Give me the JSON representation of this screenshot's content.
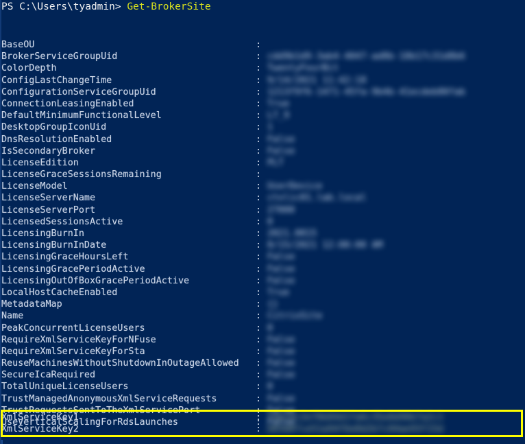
{
  "terminal": {
    "shell": "PowerShell",
    "background_color": "#012456",
    "prompt_prefix": "PS C:\\Users\\tyadmin> ",
    "command": "Get-BrokerSite",
    "command_color": "#d7e01f",
    "text_color": "#ccd5e6",
    "highlight_color": "#ffff00"
  },
  "output": {
    "properties": [
      {
        "name": "BaseOU",
        "value": ""
      },
      {
        "name": "BrokerServiceGroupUid",
        "value": "cdd9b1d9-3ab4-4047-ad8b-18b17c31d8b6"
      },
      {
        "name": "ColorDepth",
        "value": "TwentyFourBit"
      },
      {
        "name": "ConfigLastChangeTime",
        "value": "9/14/2021 11:42:18"
      },
      {
        "name": "ConfigurationServiceGroupUid",
        "value": "1213f9f6-1471-45fa-9b4b-41ecdeb80fab"
      },
      {
        "name": "ConnectionLeasingEnabled",
        "value": "True"
      },
      {
        "name": "DefaultMinimumFunctionalLevel",
        "value": "L7_9"
      },
      {
        "name": "DesktopGroupIconUid",
        "value": "1"
      },
      {
        "name": "DnsResolutionEnabled",
        "value": "False"
      },
      {
        "name": "IsSecondaryBroker",
        "value": "False"
      },
      {
        "name": "LicenseEdition",
        "value": "PLT"
      },
      {
        "name": "LicenseGraceSessionsRemaining",
        "value": ""
      },
      {
        "name": "LicenseModel",
        "value": "UserDevice"
      },
      {
        "name": "LicenseServerName",
        "value": "ctxlic01.lab.local"
      },
      {
        "name": "LicenseServerPort",
        "value": "27000"
      },
      {
        "name": "LicensedSessionsActive",
        "value": "0"
      },
      {
        "name": "LicensingBurnIn",
        "value": "2021.0815"
      },
      {
        "name": "LicensingBurnInDate",
        "value": "8/15/2021 12:00:00 AM"
      },
      {
        "name": "LicensingGraceHoursLeft",
        "value": "False"
      },
      {
        "name": "LicensingGracePeriodActive",
        "value": "False"
      },
      {
        "name": "LicensingOutOfBoxGracePeriodActive",
        "value": "False"
      },
      {
        "name": "LocalHostCacheEnabled",
        "value": "True"
      },
      {
        "name": "MetadataMap",
        "value": "{}"
      },
      {
        "name": "Name",
        "value": "CitrixSite"
      },
      {
        "name": "PeakConcurrentLicenseUsers",
        "value": "0"
      },
      {
        "name": "RequireXmlServiceKeyForNFuse",
        "value": "False"
      },
      {
        "name": "RequireXmlServiceKeyForSta",
        "value": "False"
      },
      {
        "name": "ReuseMachinesWithoutShutdownInOutageAllowed",
        "value": "False"
      },
      {
        "name": "SecureIcaRequired",
        "value": "False"
      },
      {
        "name": "TotalUniqueLicenseUsers",
        "value": "0"
      },
      {
        "name": "TrustManagedAnonymousXmlServiceRequests",
        "value": "False"
      },
      {
        "name": "TrustRequestsSentToTheXmlServicePort",
        "value": "False"
      },
      {
        "name": "UseVerticalScalingForRdsLaunches",
        "value": "False"
      }
    ],
    "highlighted_properties": [
      {
        "name": "XmlServiceKey1",
        "value": "f4a19c2e70b84d1fa6c35e8d90b7a2c1"
      },
      {
        "name": "XmlServiceKey2",
        "value": "b83d07ce51a94f6e8d2b7c04ae93f15d"
      }
    ],
    "separator": ":"
  }
}
